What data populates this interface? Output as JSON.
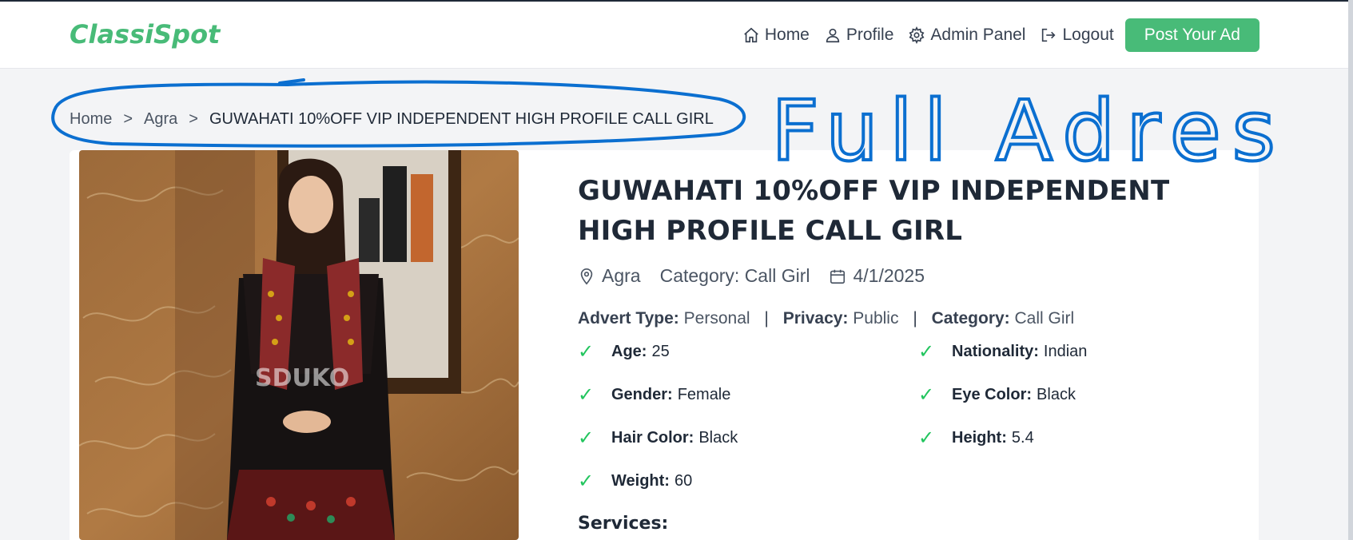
{
  "brand": {
    "name": "ClassiSpot",
    "color": "#48bb78"
  },
  "nav": {
    "items": [
      {
        "label": "Home",
        "icon": "home-icon"
      },
      {
        "label": "Profile",
        "icon": "user-icon"
      },
      {
        "label": "Admin Panel",
        "icon": "gear-icon"
      },
      {
        "label": "Logout",
        "icon": "logout-icon"
      }
    ],
    "cta": "Post Your Ad"
  },
  "breadcrumb": {
    "items": [
      "Home",
      "Agra",
      "GUWAHATI 10%OFF VIP INDEPENDENT HIGH PROFILE CALL GIRL"
    ],
    "separator": ">"
  },
  "annotation": {
    "text": "Full Adres",
    "color": "#0b6fd0"
  },
  "listing": {
    "title": "GUWAHATI 10%OFF VIP INDEPENDENT HIGH PROFILE CALL GIRL",
    "location": "Agra",
    "category_line": "Category: Call Girl",
    "date": "4/1/2025",
    "image_watermark": "SDUKO",
    "advert": {
      "type_label": "Advert Type:",
      "type_value": "Personal",
      "privacy_label": "Privacy:",
      "privacy_value": "Public",
      "category_label": "Category:",
      "category_value": "Call Girl"
    },
    "attributes": [
      {
        "label": "Age:",
        "value": "25"
      },
      {
        "label": "Nationality:",
        "value": "Indian"
      },
      {
        "label": "Gender:",
        "value": "Female"
      },
      {
        "label": "Eye Color:",
        "value": "Black"
      },
      {
        "label": "Hair Color:",
        "value": "Black"
      },
      {
        "label": "Height:",
        "value": "5.4"
      },
      {
        "label": "Weight:",
        "value": "60"
      }
    ],
    "check_glyph": "✓",
    "services_heading": "Services:"
  }
}
